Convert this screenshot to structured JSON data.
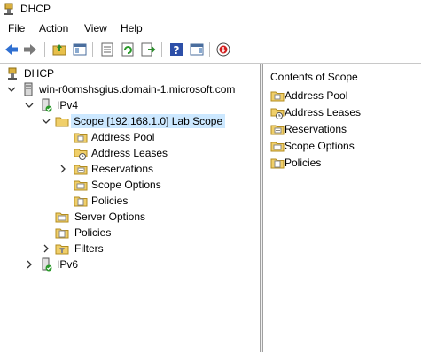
{
  "window": {
    "title": "DHCP"
  },
  "menu": [
    "File",
    "Action",
    "View",
    "Help"
  ],
  "toolbar": {
    "buttons": [
      "back-icon",
      "forward-icon",
      "up-folder-icon",
      "show-hide-tree-icon",
      "properties-icon",
      "refresh-icon",
      "export-list-icon",
      "help-icon",
      "show-action-pane-icon",
      "stop-icon"
    ]
  },
  "tree": {
    "root": "DHCP",
    "server": "win-r0omshsgius.domain-1.microsoft.com",
    "ipv4": "IPv4",
    "scope": "Scope [192.168.1.0] Lab Scope",
    "scope_children": [
      "Address Pool",
      "Address Leases",
      "Reservations",
      "Scope Options",
      "Policies"
    ],
    "server_options": "Server Options",
    "policies": "Policies",
    "filters": "Filters",
    "ipv6": "IPv6"
  },
  "right_pane": {
    "header": "Contents of Scope",
    "items": [
      "Address Pool",
      "Address Leases",
      "Reservations",
      "Scope Options",
      "Policies"
    ]
  }
}
